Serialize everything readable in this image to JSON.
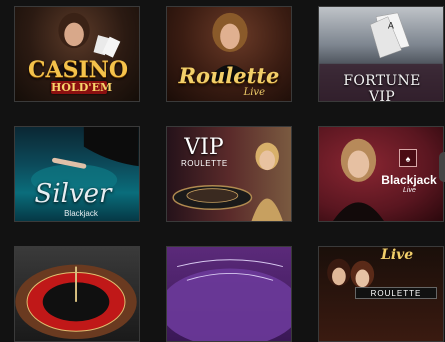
{
  "lobby": {
    "tiles": [
      {
        "title": "CASINO",
        "subtitle": "HOLD'EM"
      },
      {
        "title": "Roulette",
        "subtitle": "Live"
      },
      {
        "title": "FORTUNE VIP"
      },
      {
        "title": "Silver",
        "subtitle": "Blackjack"
      },
      {
        "title": "VIP",
        "subtitle": "ROULETTE"
      },
      {
        "title": "Blackjack",
        "subtitle": "Live"
      },
      {
        "title": ""
      },
      {
        "title": ""
      },
      {
        "title": "Live",
        "subtitle": "ROULETTE"
      }
    ]
  }
}
